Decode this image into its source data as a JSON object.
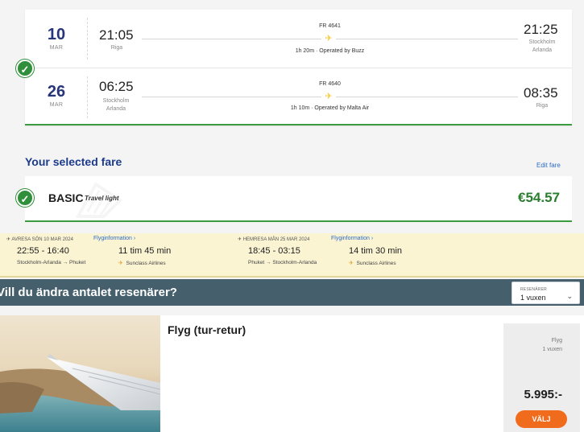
{
  "flights": [
    {
      "day": "10",
      "month": "MAR",
      "dep_time": "21:05",
      "dep_city": [
        "Riga"
      ],
      "flight_number": "FR 4641",
      "duration_operator": "1h 20m · Operated by Buzz",
      "arr_time": "21:25",
      "arr_city": [
        "Stockholm",
        "Arlanda"
      ]
    },
    {
      "day": "26",
      "month": "MAR",
      "dep_time": "06:25",
      "dep_city": [
        "Stockholm",
        "Arlanda"
      ],
      "flight_number": "FR 4640",
      "duration_operator": "1h 10m · Operated by Malta Air",
      "arr_time": "08:35",
      "arr_city": [
        "Riga"
      ]
    }
  ],
  "fare": {
    "heading": "Your selected fare",
    "edit_label": "Edit fare",
    "name": "BASIC",
    "tagline": "Travel light",
    "price": "€54.57"
  },
  "itinerary": [
    {
      "label": "AVRESA SÖN 10 MAR 2024",
      "info_link": "Flyginformation",
      "times": "22:55 - 16:40",
      "route": "Stockholm-Arlanda → Phuket",
      "duration": "11 tim 45 min",
      "airline": "Sunclass Airlines"
    },
    {
      "label": "HEMRESA MÅN 25 MAR 2024",
      "info_link": "Flyginformation",
      "times": "18:45 - 03:15",
      "route": "Phuket → Stockholm-Arlanda",
      "duration": "14 tim 30 min",
      "airline": "Sunclass Airlines"
    }
  ],
  "travellers": {
    "question": "Vill du ändra antalet resenärer?",
    "select_label": "RESENÄRER",
    "select_value": "1 vuxen"
  },
  "result": {
    "title": "Flyg (tur-retur)",
    "price_line1": "Flyg",
    "price_line2": "1 vuxen",
    "price": "5.995:-",
    "button_label": "VÄLJ"
  },
  "colors": {
    "brand_blue": "#073590",
    "selected_green": "#2f8f3a",
    "plane_yellow": "#f1c933",
    "cta_orange": "#f16b1c",
    "strip_yellow": "#fbf4d3",
    "bar_teal": "#45606c"
  }
}
